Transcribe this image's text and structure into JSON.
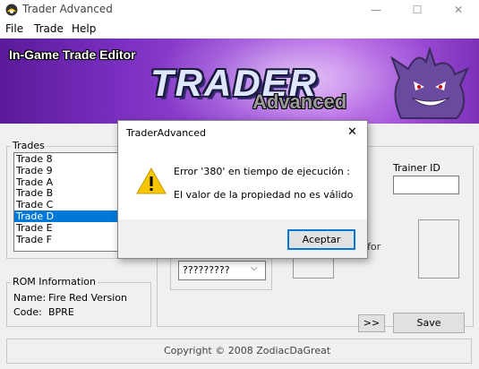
{
  "window": {
    "title": "Trader Advanced",
    "minimize": "—",
    "maximize": "☐",
    "close": "✕"
  },
  "menu": [
    "File",
    "Trade",
    "Help"
  ],
  "banner": {
    "heading": "In-Game Trade Editor",
    "logo_main": "TRADER",
    "logo_sub": "Advanced"
  },
  "trades": {
    "legend": "Trades",
    "items": [
      "Trade 8",
      "Trade 9",
      "Trade A",
      "Trade B",
      "Trade C",
      "Trade D",
      "Trade E",
      "Trade F"
    ],
    "selected_index": 5
  },
  "rom_info": {
    "legend": "ROM Information",
    "name_label": "Name:",
    "name_value": "Fire Red Version",
    "code_label": "Code:",
    "code_value": "BPRE"
  },
  "trainer": {
    "id_label": "Trainer ID",
    "id_value": "",
    "for_label": "for"
  },
  "pokemon_select": {
    "value": "?????????"
  },
  "buttons": {
    "next": ">>",
    "save": "Save"
  },
  "footer": {
    "copyright": "Copyright © 2008 ZodiacDaGreat"
  },
  "dialog": {
    "title": "TraderAdvanced",
    "close": "✕",
    "message_line1": "Error '380' en tiempo de ejecución :",
    "message_line2": "El valor de la propiedad no es válido",
    "ok": "Aceptar",
    "icon": "warning-icon"
  },
  "colors": {
    "selection": "#0078d7",
    "banner_purple": "#7a2fc0",
    "warning_yellow": "#f7c600"
  }
}
